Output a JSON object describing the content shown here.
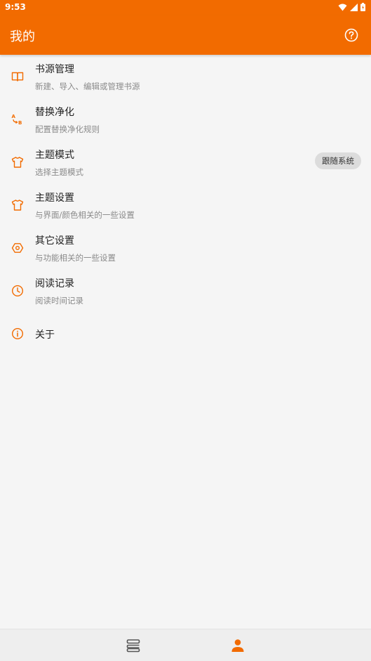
{
  "status_bar": {
    "time": "9:53"
  },
  "header": {
    "title": "我的"
  },
  "menu": [
    {
      "key": "book-source",
      "title": "书源管理",
      "subtitle": "新建、导入、编辑或管理书源"
    },
    {
      "key": "replace-purify",
      "title": "替换净化",
      "subtitle": "配置替换净化规则"
    },
    {
      "key": "theme-mode",
      "title": "主题模式",
      "subtitle": "选择主题模式",
      "value": "跟随系统"
    },
    {
      "key": "theme-settings",
      "title": "主题设置",
      "subtitle": "与界面/颜色相关的一些设置"
    },
    {
      "key": "other-settings",
      "title": "其它设置",
      "subtitle": "与功能相关的一些设置"
    },
    {
      "key": "read-record",
      "title": "阅读记录",
      "subtitle": "阅读时间记录"
    },
    {
      "key": "about",
      "title": "关于"
    }
  ],
  "colors": {
    "accent": "#f26b00",
    "background": "#f5f5f5",
    "chip": "#dcdcdc"
  },
  "bottom_nav": {
    "icons": [
      "bookshelf-icon",
      "person-icon"
    ],
    "selected": "person-icon"
  }
}
